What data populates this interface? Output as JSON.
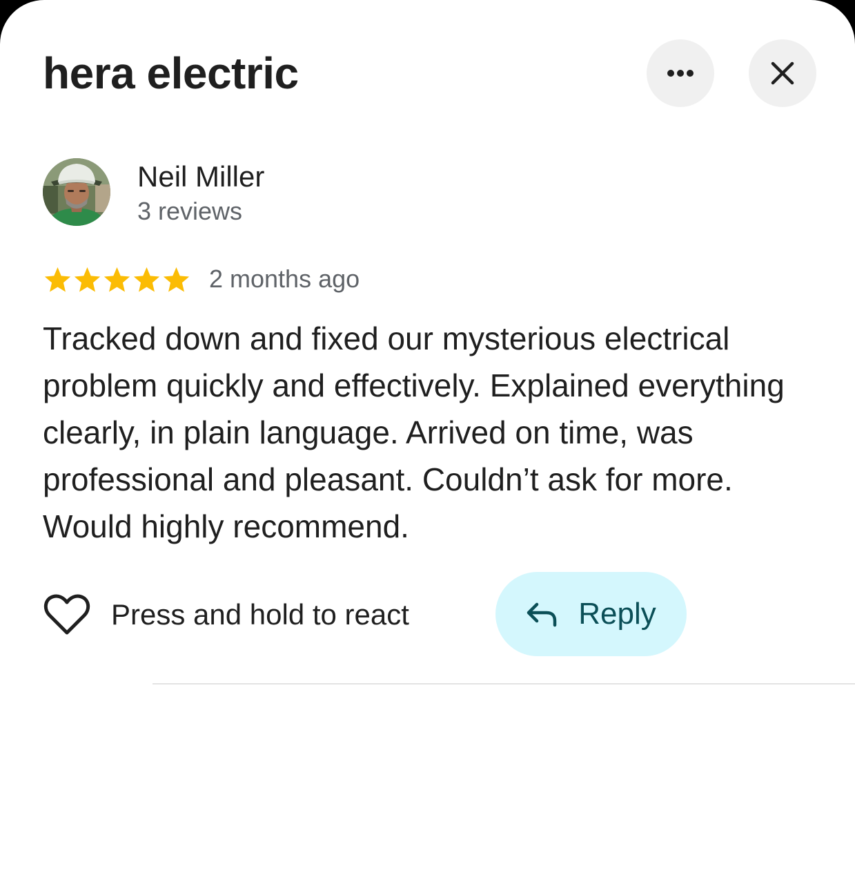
{
  "header": {
    "title": "hera electric",
    "more_button_icon": "more-horizontal-icon",
    "close_button_icon": "close-icon"
  },
  "reviewer": {
    "name": "Neil Miller",
    "review_count": "3 reviews",
    "avatar_icon": "user-avatar-photo"
  },
  "review": {
    "rating": 5,
    "rating_max": 5,
    "date": "2 months ago",
    "text": "Tracked down and fixed our mysterious electrical problem quickly and effectively. Explained everything clearly, in plain language. Arrived on time, was professional and pleasant. Couldn’t ask for more. Would highly recommend."
  },
  "actions": {
    "react_label": "Press and hold to react",
    "react_icon": "heart-outline-icon",
    "reply_label": "Reply",
    "reply_icon": "reply-arrow-icon"
  },
  "colors": {
    "star": "#fbbc04",
    "reply_background": "#d4f7fd",
    "reply_text": "#0b4f57",
    "secondary_text": "#5f6368",
    "primary_text": "#1f1f1f"
  }
}
